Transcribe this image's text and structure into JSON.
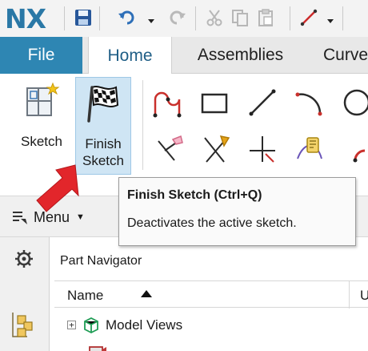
{
  "app": {
    "logo": "NX"
  },
  "quick_access": {
    "icons": [
      "save-icon",
      "undo-icon",
      "dropdown-caret-icon",
      "redo-icon",
      "cut-icon",
      "copy-icon",
      "paste-icon",
      "line-tool-icon",
      "dropdown-caret-icon"
    ]
  },
  "tabs": [
    {
      "label": "File",
      "active": false
    },
    {
      "label": "Home",
      "active": true
    },
    {
      "label": "Assemblies",
      "active": false
    },
    {
      "label": "Curve",
      "active": false
    }
  ],
  "ribbon": {
    "sketch_label": "Sketch",
    "finish_sketch_label": "Finish Sketch",
    "tools": [
      "profile-icon",
      "rectangle-icon",
      "line-icon",
      "arc-icon",
      "circle-icon",
      "quick-trim-icon",
      "quick-extend-icon",
      "make-corner-icon",
      "geometric-constraints-icon",
      "fillet-icon"
    ]
  },
  "menu": {
    "label": "Menu"
  },
  "tooltip": {
    "title": "Finish Sketch (Ctrl+Q)",
    "description": "Deactivates the active sketch."
  },
  "navigator": {
    "title": "Part Navigator",
    "columns": {
      "name": "Name",
      "up": "Up"
    },
    "rows": [
      {
        "label": "Model Views",
        "expander": "+"
      }
    ]
  },
  "colors": {
    "brand": "#2a78a6",
    "file_tab": "#2e86b3",
    "active_button_bg": "#cfe5f4",
    "callout_arrow": "#e2262b"
  }
}
